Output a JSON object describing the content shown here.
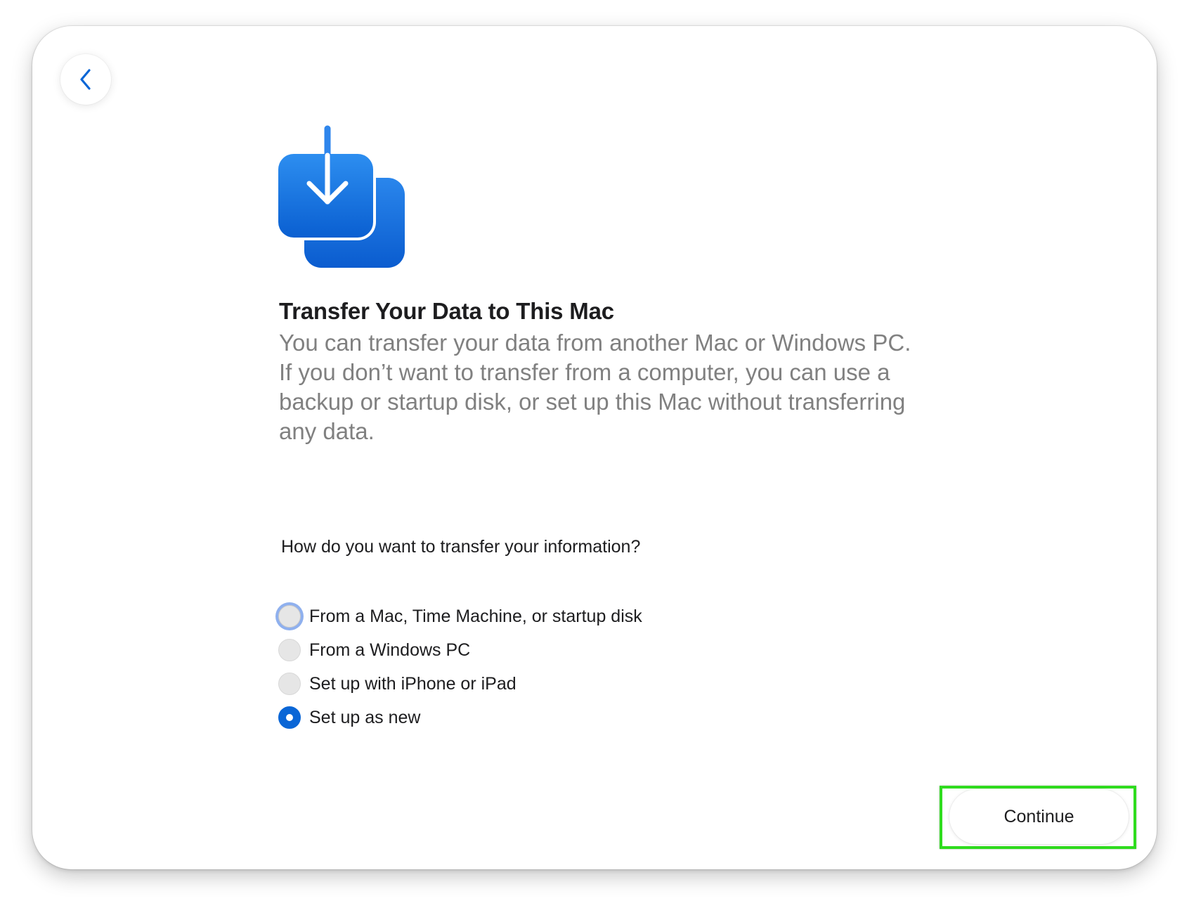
{
  "colors": {
    "accent": "#0a66d6",
    "icon_gradient_top": "#2d8ef0",
    "icon_gradient_bottom": "#0a5fd1",
    "highlight": "#2fdc1e"
  },
  "header": {
    "back_icon": "chevron-left-icon",
    "hero_icon": "download-transfer-icon"
  },
  "main": {
    "title": "Transfer Your Data to This Mac",
    "description": "You can transfer your data from another Mac or Windows PC. If you don’t want to transfer from a computer, you can use a backup or startup disk, or set up this Mac without transferring any data.",
    "question": "How do you want to transfer your information?",
    "options": [
      {
        "label": "From a Mac, Time Machine, or startup disk",
        "state": "focused"
      },
      {
        "label": "From a Windows PC",
        "state": "unselected"
      },
      {
        "label": "Set up with iPhone or iPad",
        "state": "unselected"
      },
      {
        "label": "Set up as new",
        "state": "selected"
      }
    ],
    "selected_option": "Set up as new"
  },
  "footer": {
    "continue_label": "Continue"
  }
}
